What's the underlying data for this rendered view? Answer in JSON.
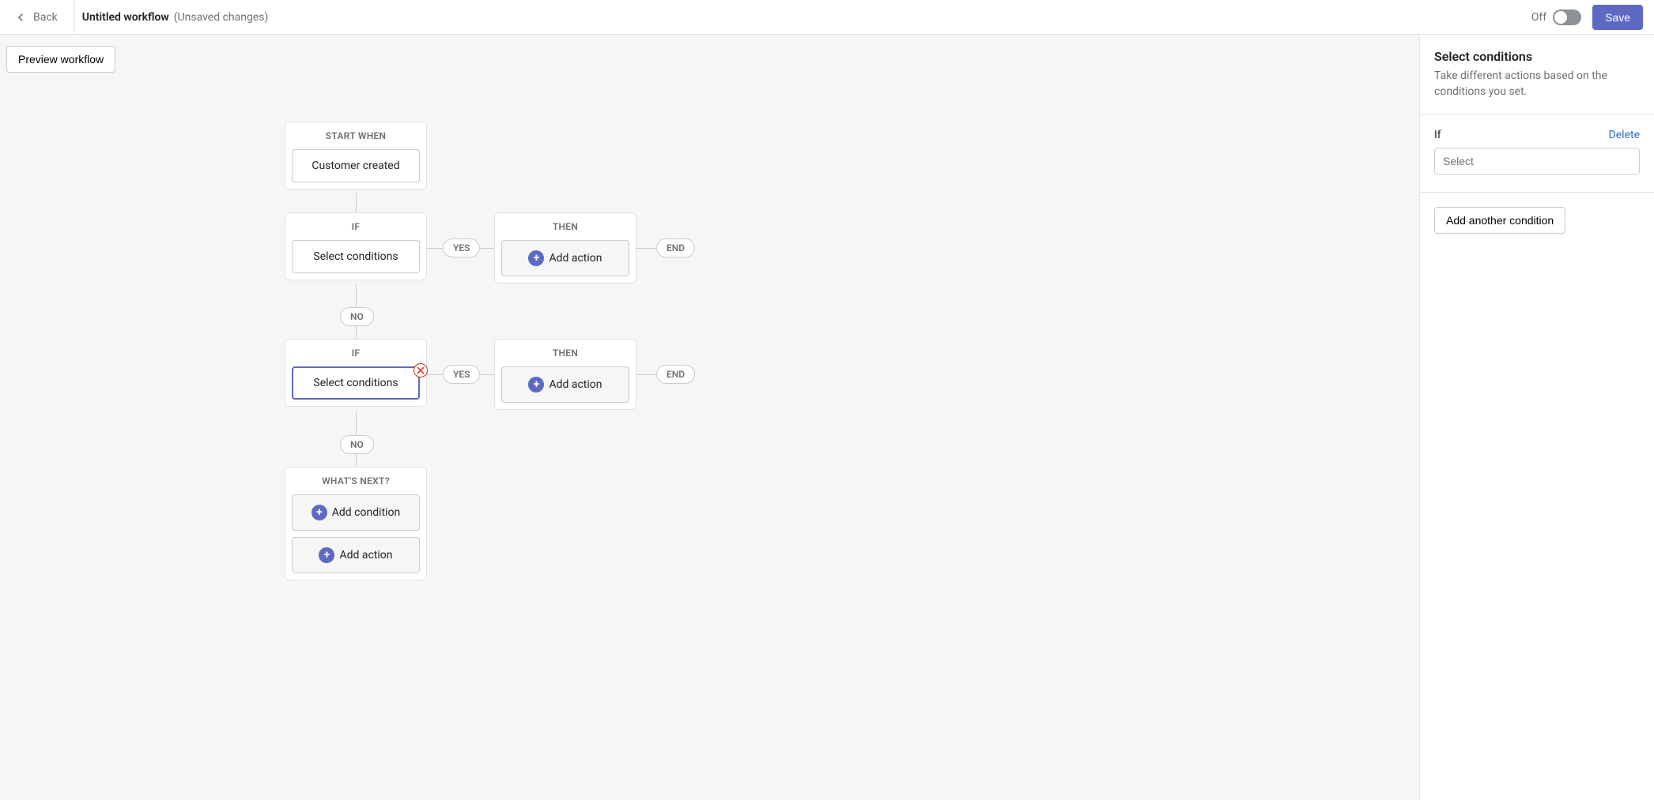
{
  "header": {
    "back": "Back",
    "title": "Untitled workflow",
    "subtitle": "(Unsaved changes)",
    "toggle_label": "Off",
    "save": "Save"
  },
  "canvas": {
    "preview": "Preview workflow",
    "start_header": "START WHEN",
    "start_body": "Customer created",
    "if_header": "IF",
    "if_body": "Select conditions",
    "then_header": "THEN",
    "add_action": "Add action",
    "yes": "YES",
    "no": "NO",
    "end": "END",
    "next_header": "WHAT'S NEXT?",
    "add_condition": "Add condition"
  },
  "sidebar": {
    "title": "Select conditions",
    "desc": "Take different actions based on the conditions you set.",
    "if_label": "If",
    "delete": "Delete",
    "select_placeholder": "Select",
    "add_another": "Add another condition"
  }
}
